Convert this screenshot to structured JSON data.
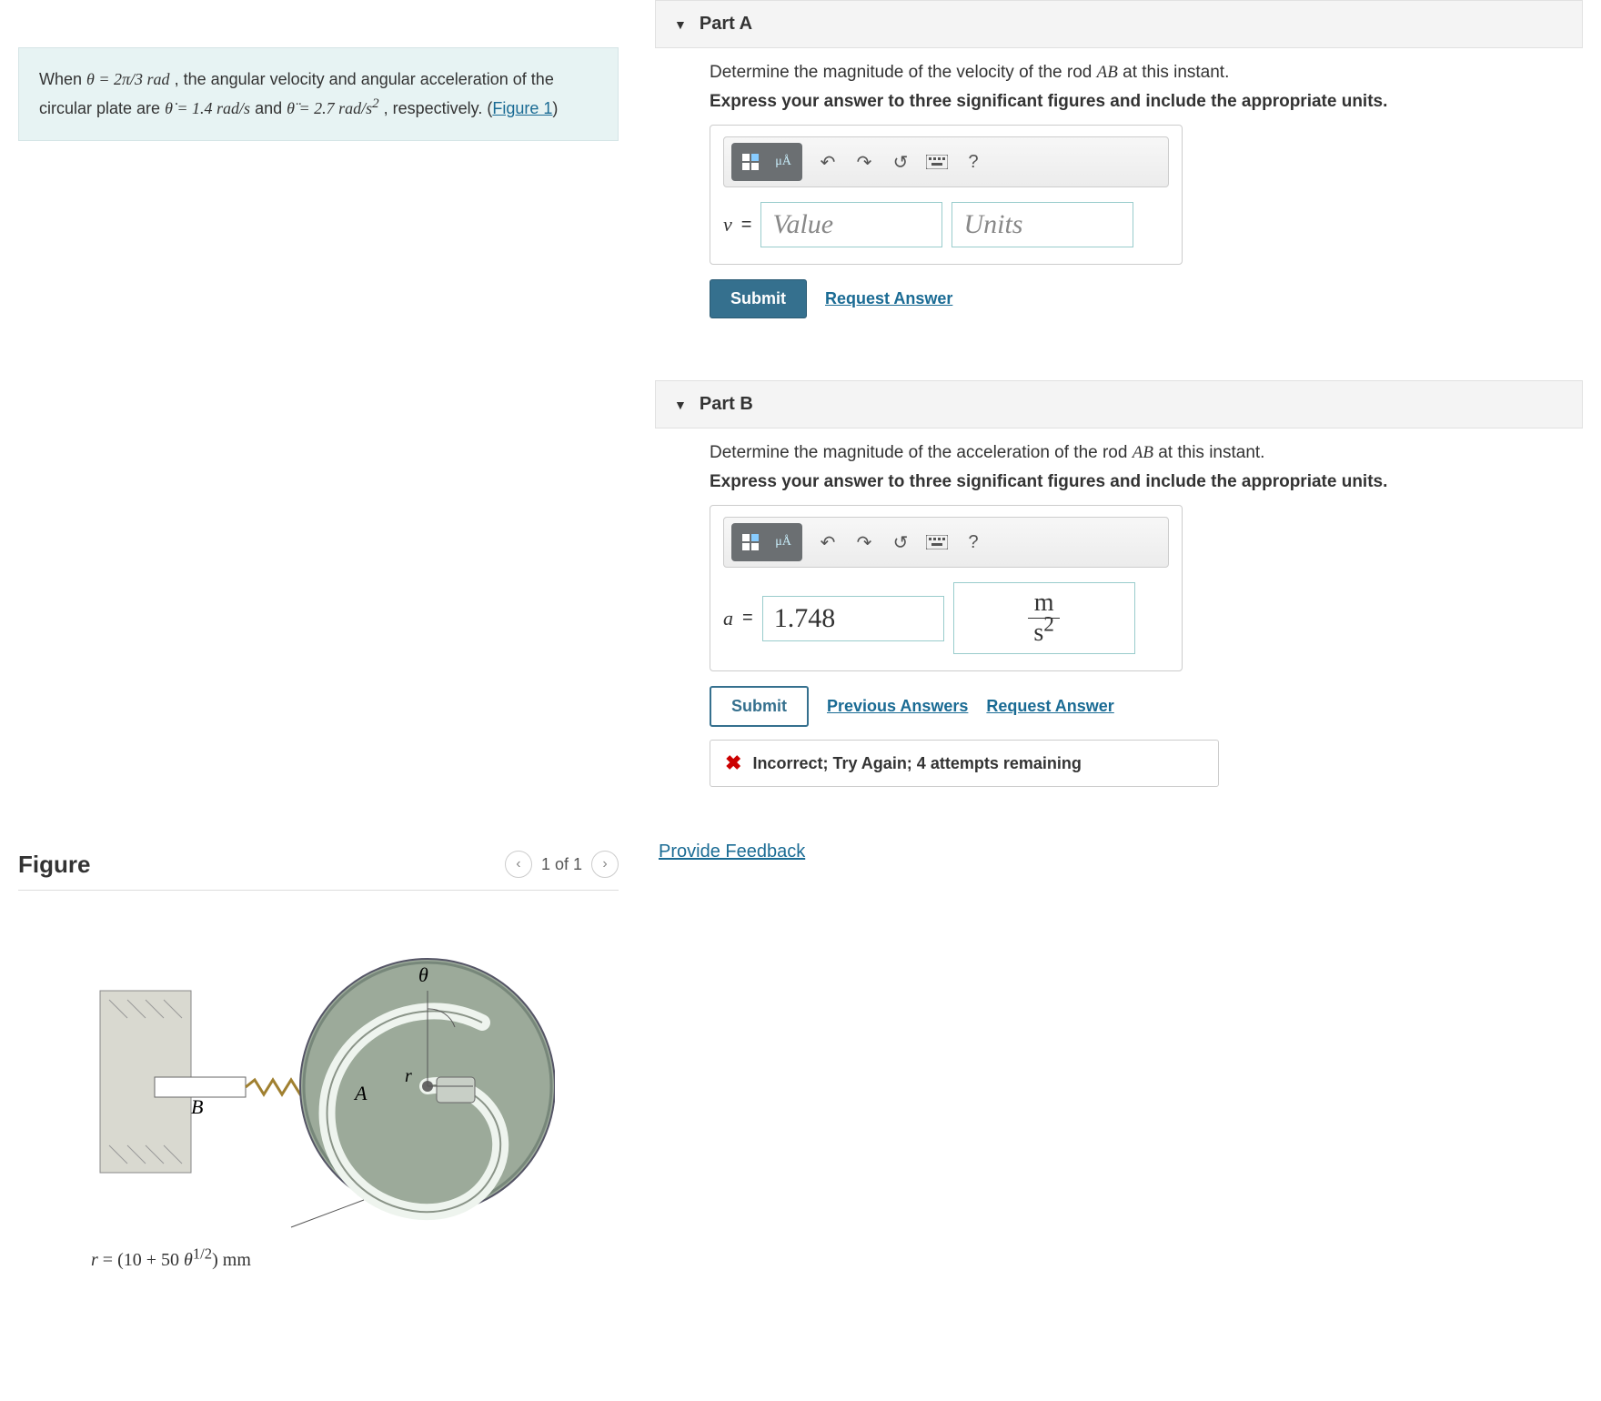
{
  "problem": {
    "text_prefix": "When ",
    "theta": "θ = 2π/3 rad",
    "text_mid1": ", the angular velocity and angular acceleration of the circular plate are ",
    "thetadot": "θ̇ = 1.4 rad/s",
    "text_and": " and ",
    "thetaddot": "θ̈ = 2.7 rad/s²",
    "text_suffix": ", respectively. (",
    "figure_link": "Figure 1",
    "close": ")"
  },
  "figure": {
    "title": "Figure",
    "pager": "1 of 1",
    "caption": "r = (10 + 50 θ^{1/2}) mm",
    "labels": {
      "A": "A",
      "B": "B",
      "theta": "θ",
      "r": "r"
    }
  },
  "partA": {
    "title": "Part A",
    "prompt_pre": "Determine the magnitude of the velocity of the rod ",
    "prompt_rod": "AB",
    "prompt_post": " at this instant.",
    "hint": "Express your answer to three significant figures and include the appropriate units.",
    "var": "v",
    "value_placeholder": "Value",
    "units_placeholder": "Units",
    "submit": "Submit",
    "request": "Request Answer"
  },
  "partB": {
    "title": "Part B",
    "prompt_pre": "Determine the magnitude of the acceleration of the rod ",
    "prompt_rod": "AB",
    "prompt_post": " at this instant.",
    "hint": "Express your answer to three significant figures and include the appropriate units.",
    "var": "a",
    "value": "1.748",
    "units_num": "m",
    "units_den": "s²",
    "submit": "Submit",
    "prev": "Previous Answers",
    "request": "Request Answer",
    "feedback": "Incorrect; Try Again; 4 attempts remaining"
  },
  "footer": {
    "provide_feedback": "Provide Feedback"
  },
  "toolbar_help": "?"
}
